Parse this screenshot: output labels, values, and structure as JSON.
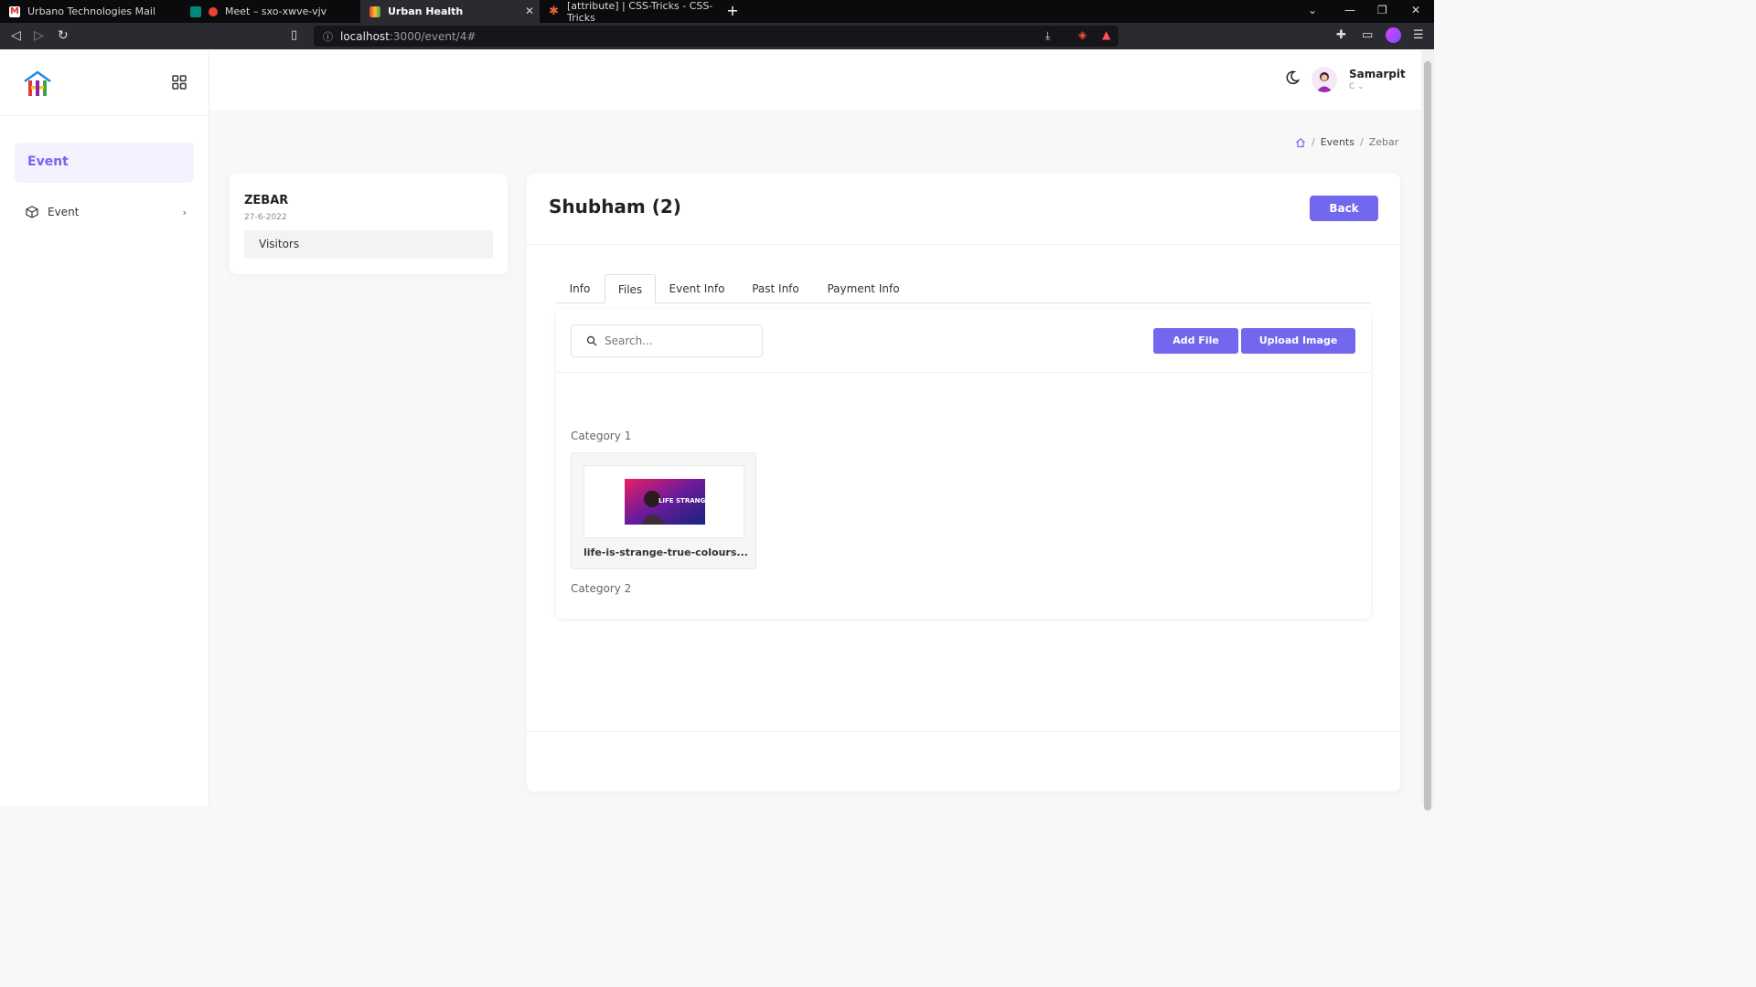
{
  "browser": {
    "tabs": [
      {
        "title": "Urbano Technologies Mail",
        "active": false
      },
      {
        "title": "Meet – sxo-xwve-vjv",
        "active": false
      },
      {
        "title": "Urban Health",
        "active": true
      },
      {
        "title": "[attribute] | CSS-Tricks - CSS-Tricks",
        "active": false
      }
    ],
    "url_host": "localhost",
    "url_path": ":3000/event/4#"
  },
  "sidebar": {
    "header": "Event",
    "items": [
      {
        "label": "Event",
        "icon": "box-icon"
      }
    ]
  },
  "user": {
    "name": "Samarpit",
    "role": "C"
  },
  "breadcrumb": {
    "items": [
      "Events",
      "Zebar"
    ]
  },
  "event_card": {
    "title": "ZEBAR",
    "date": "27-6-2022",
    "menu_item": "Visitors"
  },
  "main": {
    "title": "Shubham (2)",
    "back_label": "Back",
    "tabs": [
      "Info",
      "Files",
      "Event Info",
      "Past Info",
      "Payment Info"
    ],
    "active_tab": "Files",
    "search_placeholder": "Search...",
    "add_file_label": "Add File",
    "upload_image_label": "Upload Image",
    "categories": [
      {
        "name": "Category 1",
        "files": [
          {
            "name": "life-is-strange-true-colours..."
          }
        ]
      },
      {
        "name": "Category 2",
        "files": []
      }
    ]
  },
  "colors": {
    "accent": "#7367f0",
    "page_bg": "#f8f8f8"
  }
}
